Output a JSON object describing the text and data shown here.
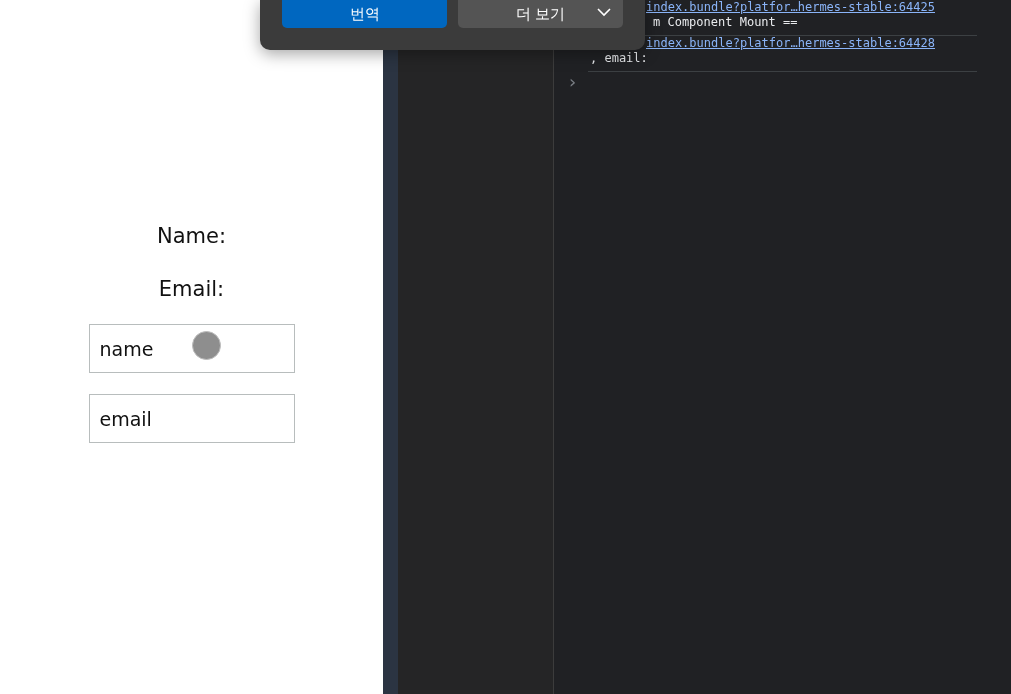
{
  "app": {
    "labels": [
      "Name:",
      "Email:"
    ],
    "fields": [
      {
        "placeholder": "name"
      },
      {
        "placeholder": "email"
      }
    ]
  },
  "translate_popup": {
    "buttons": [
      {
        "label": "번역",
        "kind": "primary"
      },
      {
        "label": "더 보기",
        "kind": "dropdown"
      }
    ]
  },
  "console": {
    "entries": [
      {
        "link": "index.bundle?platfor…hermes-stable:64425",
        "message": "m Component Mount =="
      },
      {
        "link": "index.bundle?platfor…hermes-stable:64428",
        "message": ", email:"
      }
    ],
    "prompt": "›"
  }
}
